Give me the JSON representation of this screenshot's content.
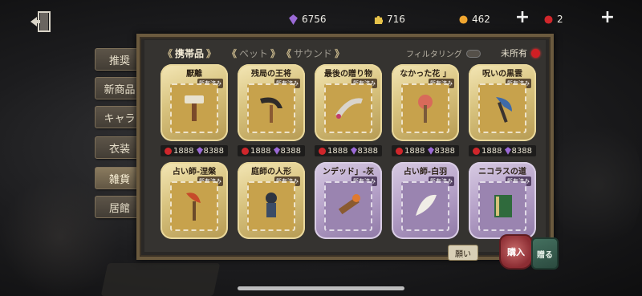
{
  "top_bar": {
    "currencies": [
      {
        "icon": "purple-gem-icon",
        "value": "6756"
      },
      {
        "icon": "puzzle-clue-icon",
        "value": "716"
      },
      {
        "icon": "gold-coin-icon",
        "value": "462"
      },
      {
        "icon": "red-gem-icon",
        "value": "2"
      }
    ],
    "plus_label": "+"
  },
  "categories": [
    {
      "label": "推奨",
      "active": false
    },
    {
      "label": "新商品",
      "active": false
    },
    {
      "label": "キャラ",
      "active": false
    },
    {
      "label": "衣装",
      "active": false
    },
    {
      "label": "雑貨",
      "active": true
    },
    {
      "label": "居館",
      "active": false
    }
  ],
  "subtabs": [
    {
      "label": "携帯品",
      "active": true
    },
    {
      "label": "ペット",
      "active": false
    },
    {
      "label": "サウンド",
      "active": false
    }
  ],
  "filter_label": "フィルタリング",
  "unowned_label": "未所有",
  "items": [
    {
      "name": "厭離",
      "owned": "所有済み",
      "rarity": "gold",
      "price_red": "1888",
      "price_purple": "8388"
    },
    {
      "name": "残局の王将",
      "owned": "所有済み",
      "rarity": "gold",
      "price_red": "1888",
      "price_purple": "8388"
    },
    {
      "name": "最後の贈り物",
      "owned": "所有済み",
      "rarity": "gold",
      "price_red": "1888",
      "price_purple": "8388"
    },
    {
      "name": "なかった花 」",
      "owned": "所有済み",
      "rarity": "gold",
      "price_red": "1888",
      "price_purple": "8388"
    },
    {
      "name": "呪いの黒雲",
      "owned": "所有済み",
      "rarity": "gold",
      "price_red": "1888",
      "price_purple": "8388"
    },
    {
      "name": "占い師-涅槃",
      "owned": "所有済み",
      "rarity": "gold"
    },
    {
      "name": "庭師の人形",
      "owned": "所有済み",
      "rarity": "gold"
    },
    {
      "name": "ンデッド」-灰",
      "owned": "所有済み",
      "rarity": "purple"
    },
    {
      "name": "占い師-白羽",
      "owned": "所有済み",
      "rarity": "purple"
    },
    {
      "name": "ニコラスの道",
      "owned": "所有済み",
      "rarity": "purple"
    }
  ],
  "buttons": {
    "want": "願い",
    "buy": "購入",
    "gift": "贈る"
  },
  "colors": {
    "gold_card": "#d8c37f",
    "purple_card": "#b5a1c8",
    "red_currency": "#d0262b",
    "purple_currency": "#9b6ad6"
  }
}
